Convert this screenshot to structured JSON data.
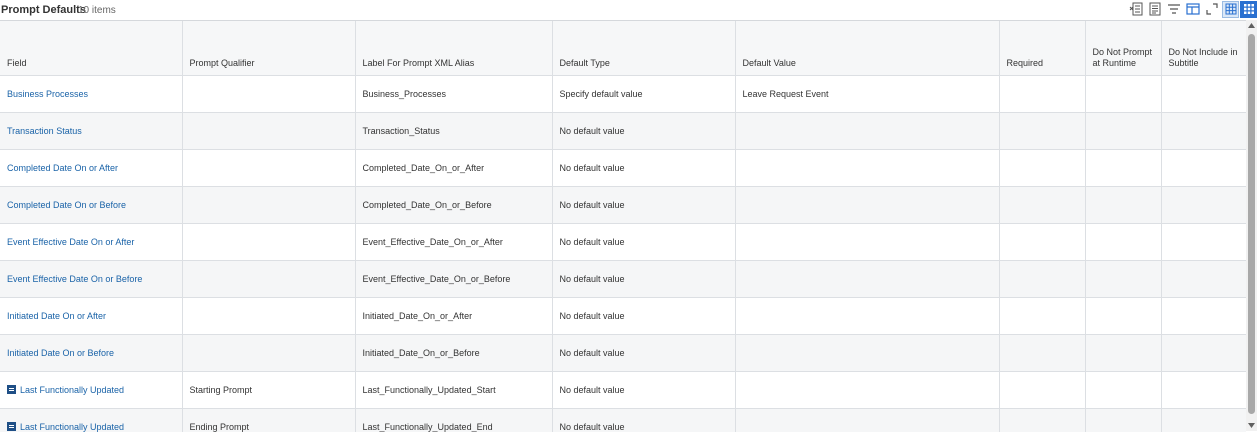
{
  "header": {
    "title": "Prompt Defaults",
    "count": "10 items"
  },
  "toolbar": {
    "icons": [
      "export-to-excel-icon",
      "export-to-pdf-icon",
      "filter-icon",
      "column-layout-icon",
      "fullscreen-icon",
      "grid-view-icon",
      "tile-view-icon"
    ]
  },
  "table": {
    "columns": [
      "Field",
      "Prompt Qualifier",
      "Label For Prompt XML Alias",
      "Default Type",
      "Default Value",
      "Required",
      "Do Not Prompt at Runtime",
      "Do Not Include in Subtitle"
    ],
    "rows": [
      {
        "field": "Business Processes",
        "qualifier": "",
        "alias": "Business_Processes",
        "default_type": "Specify default value",
        "default_value": "Leave Request Event",
        "required": "",
        "no_prompt": "",
        "no_subtitle": "",
        "icon": false
      },
      {
        "field": "Transaction Status",
        "qualifier": "",
        "alias": "Transaction_Status",
        "default_type": "No default value",
        "default_value": "",
        "required": "",
        "no_prompt": "",
        "no_subtitle": "",
        "icon": false
      },
      {
        "field": "Completed Date On or After",
        "qualifier": "",
        "alias": "Completed_Date_On_or_After",
        "default_type": "No default value",
        "default_value": "",
        "required": "",
        "no_prompt": "",
        "no_subtitle": "",
        "icon": false
      },
      {
        "field": "Completed Date On or Before",
        "qualifier": "",
        "alias": "Completed_Date_On_or_Before",
        "default_type": "No default value",
        "default_value": "",
        "required": "",
        "no_prompt": "",
        "no_subtitle": "",
        "icon": false
      },
      {
        "field": "Event Effective Date On or After",
        "qualifier": "",
        "alias": "Event_Effective_Date_On_or_After",
        "default_type": "No default value",
        "default_value": "",
        "required": "",
        "no_prompt": "",
        "no_subtitle": "",
        "icon": false
      },
      {
        "field": "Event Effective Date On or Before",
        "qualifier": "",
        "alias": "Event_Effective_Date_On_or_Before",
        "default_type": "No default value",
        "default_value": "",
        "required": "",
        "no_prompt": "",
        "no_subtitle": "",
        "icon": false
      },
      {
        "field": "Initiated Date On or After",
        "qualifier": "",
        "alias": "Initiated_Date_On_or_After",
        "default_type": "No default value",
        "default_value": "",
        "required": "",
        "no_prompt": "",
        "no_subtitle": "",
        "icon": false
      },
      {
        "field": "Initiated Date On or Before",
        "qualifier": "",
        "alias": "Initiated_Date_On_or_Before",
        "default_type": "No default value",
        "default_value": "",
        "required": "",
        "no_prompt": "",
        "no_subtitle": "",
        "icon": false
      },
      {
        "field": "Last Functionally Updated",
        "qualifier": "Starting Prompt",
        "alias": "Last_Functionally_Updated_Start",
        "default_type": "No default value",
        "default_value": "",
        "required": "",
        "no_prompt": "",
        "no_subtitle": "",
        "icon": true
      },
      {
        "field": "Last Functionally Updated",
        "qualifier": "Ending Prompt",
        "alias": "Last_Functionally_Updated_End",
        "default_type": "No default value",
        "default_value": "",
        "required": "",
        "no_prompt": "",
        "no_subtitle": "",
        "icon": true
      }
    ]
  },
  "colors": {
    "link": "#1a63a8",
    "header_bg": "#f6f7f8",
    "alt_row": "#f5f6f7",
    "accent": "#2a70d0"
  }
}
